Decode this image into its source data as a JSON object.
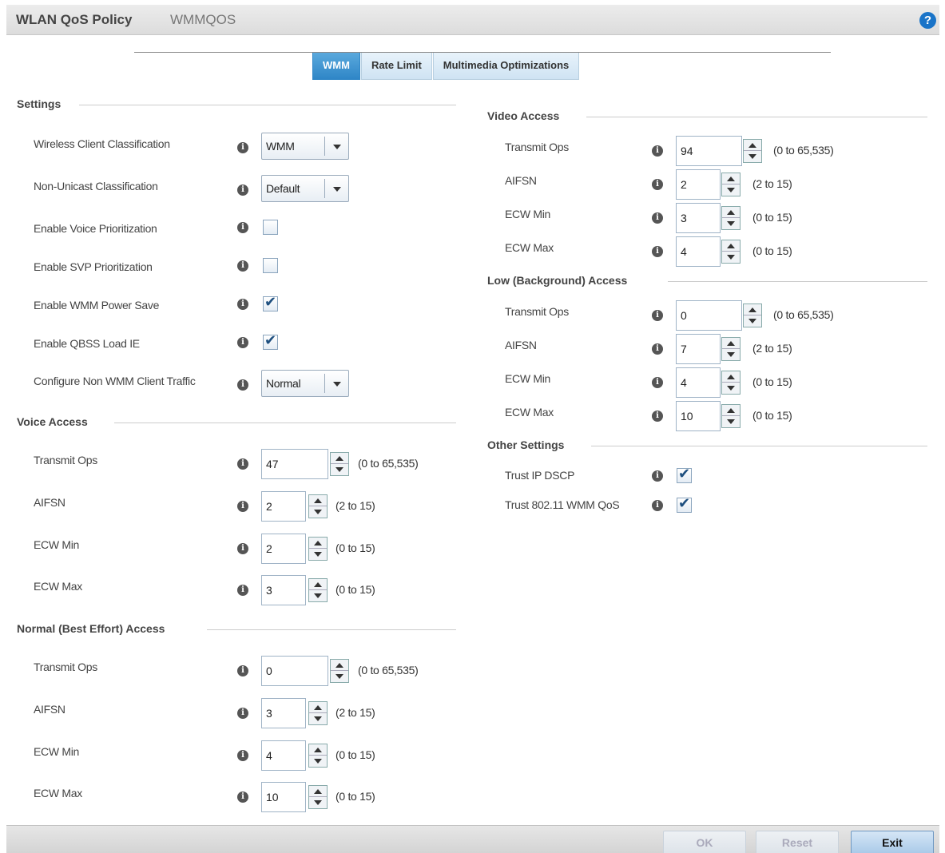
{
  "header": {
    "title": "WLAN QoS Policy",
    "subtitle": "WMMQOS",
    "help_icon": "?"
  },
  "tabs": [
    {
      "label": "WMM",
      "active": true
    },
    {
      "label": "Rate Limit",
      "active": false
    },
    {
      "label": "Multimedia Optimizations",
      "active": false
    }
  ],
  "settings": {
    "title": "Settings",
    "wireless_client_classification": {
      "label": "Wireless Client Classification",
      "value": "WMM"
    },
    "non_unicast_classification": {
      "label": "Non-Unicast Classification",
      "value": "Default"
    },
    "enable_voice_prioritization": {
      "label": "Enable Voice Prioritization",
      "checked": false
    },
    "enable_svp_prioritization": {
      "label": "Enable SVP Prioritization",
      "checked": false
    },
    "enable_wmm_power_save": {
      "label": "Enable WMM Power Save",
      "checked": true
    },
    "enable_qbss_load_ie": {
      "label": "Enable QBSS Load IE",
      "checked": true
    },
    "configure_non_wmm_client_traffic": {
      "label": "Configure Non WMM Client Traffic",
      "value": "Normal"
    }
  },
  "voice_access": {
    "title": "Voice Access",
    "transmit_ops": {
      "label": "Transmit Ops",
      "value": "47",
      "range": "(0 to 65,535)"
    },
    "aifsn": {
      "label": "AIFSN",
      "value": "2",
      "range": "(2 to 15)"
    },
    "ecw_min": {
      "label": "ECW Min",
      "value": "2",
      "range": "(0 to 15)"
    },
    "ecw_max": {
      "label": "ECW Max",
      "value": "3",
      "range": "(0 to 15)"
    }
  },
  "normal_access": {
    "title": "Normal (Best Effort) Access",
    "transmit_ops": {
      "label": "Transmit Ops",
      "value": "0",
      "range": "(0 to 65,535)"
    },
    "aifsn": {
      "label": "AIFSN",
      "value": "3",
      "range": "(2 to 15)"
    },
    "ecw_min": {
      "label": "ECW Min",
      "value": "4",
      "range": "(0 to 15)"
    },
    "ecw_max": {
      "label": "ECW Max",
      "value": "10",
      "range": "(0 to 15)"
    }
  },
  "video_access": {
    "title": "Video Access",
    "transmit_ops": {
      "label": "Transmit Ops",
      "value": "94",
      "range": "(0 to 65,535)"
    },
    "aifsn": {
      "label": "AIFSN",
      "value": "2",
      "range": "(2 to 15)"
    },
    "ecw_min": {
      "label": "ECW Min",
      "value": "3",
      "range": "(0 to 15)"
    },
    "ecw_max": {
      "label": "ECW Max",
      "value": "4",
      "range": "(0 to 15)"
    }
  },
  "low_access": {
    "title": "Low (Background) Access",
    "transmit_ops": {
      "label": "Transmit Ops",
      "value": "0",
      "range": "(0 to 65,535)"
    },
    "aifsn": {
      "label": "AIFSN",
      "value": "7",
      "range": "(2 to 15)"
    },
    "ecw_min": {
      "label": "ECW Min",
      "value": "4",
      "range": "(0 to 15)"
    },
    "ecw_max": {
      "label": "ECW Max",
      "value": "10",
      "range": "(0 to 15)"
    }
  },
  "other_settings": {
    "title": "Other Settings",
    "trust_ip_dscp": {
      "label": "Trust IP DSCP",
      "checked": true
    },
    "trust_wmm_qos": {
      "label": "Trust 802.11 WMM QoS",
      "checked": true
    }
  },
  "footer": {
    "ok_label": "OK",
    "reset_label": "Reset",
    "exit_label": "Exit"
  },
  "colors": {
    "accent": "#2f86c7",
    "help": "#1a74c8",
    "check": "#1e4f7f"
  }
}
